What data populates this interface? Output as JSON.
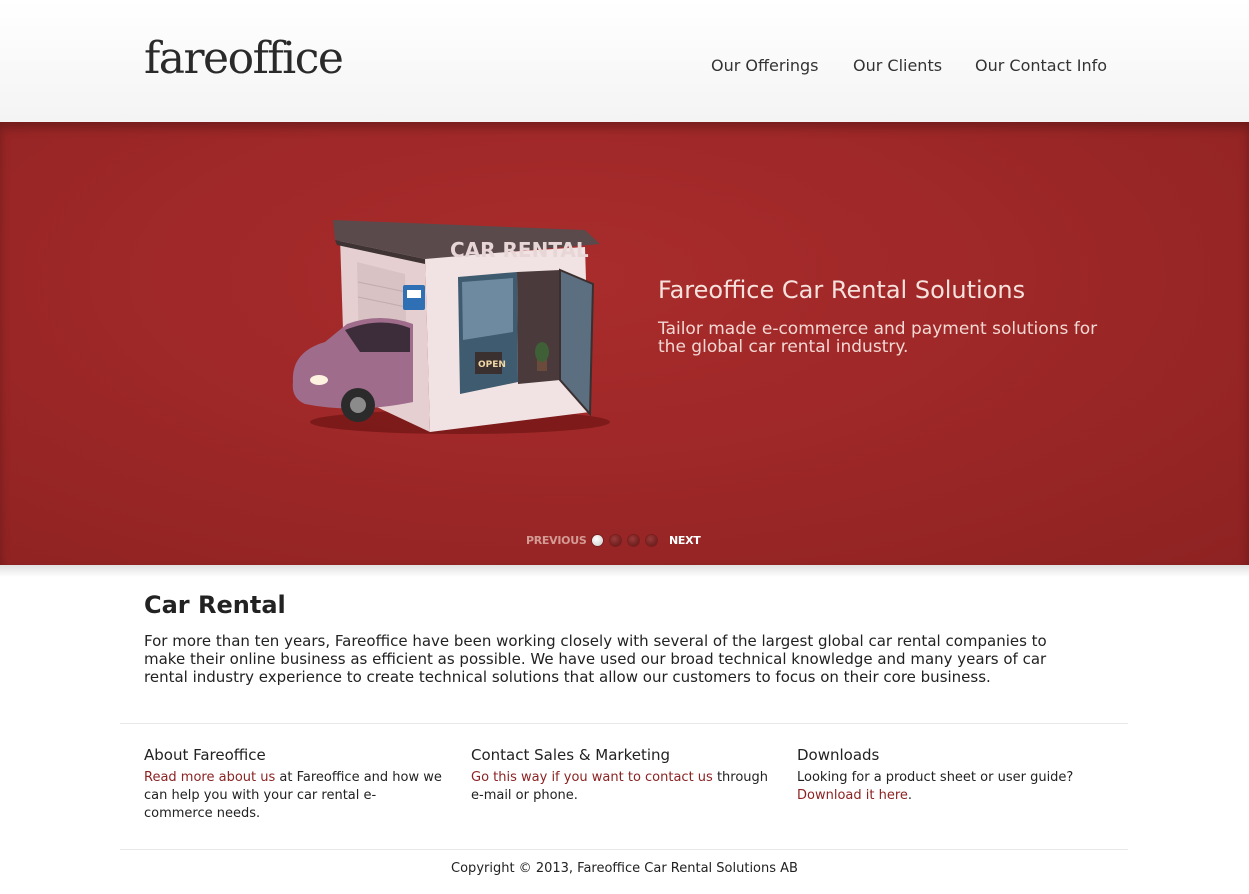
{
  "header": {
    "logo": "fareoffice",
    "nav": [
      "Our Offerings",
      "Our Clients",
      "Our Contact Info"
    ]
  },
  "hero": {
    "sign_text": "CAR RENTAL",
    "open_sign": "OPEN",
    "title": "Fareoffice Car Rental Solutions",
    "subtitle": "Tailor made e-commerce and payment solutions for the global car rental industry.",
    "prev_label": "PREVIOUS",
    "next_label": "NEXT",
    "slide_count": 4,
    "active_slide": 1
  },
  "main": {
    "title": "Car Rental",
    "text": "For more than ten years, Fareoffice have been working closely with several of the largest global car rental companies to make their online business as efficient as possible. We have used our broad technical knowledge and many years of car rental industry experience to create technical solutions that allow our customers to focus on their core business."
  },
  "columns": [
    {
      "title": "About Fareoffice",
      "link": "Read more about us",
      "text": " at Fareoffice and how we can help you with your car rental e-commerce needs."
    },
    {
      "title": "Contact Sales & Marketing",
      "link": "Go this way if you want to contact us",
      "text": " through e-mail or phone."
    },
    {
      "title": "Downloads",
      "pre": "Looking for a product sheet or user guide?",
      "link": "Download it here",
      "post": "."
    }
  ],
  "footer": {
    "copyright": "Copyright © 2013, Fareoffice Car Rental Solutions AB"
  },
  "colors": {
    "hero_bg": "#a02828",
    "link": "#8c2323"
  }
}
